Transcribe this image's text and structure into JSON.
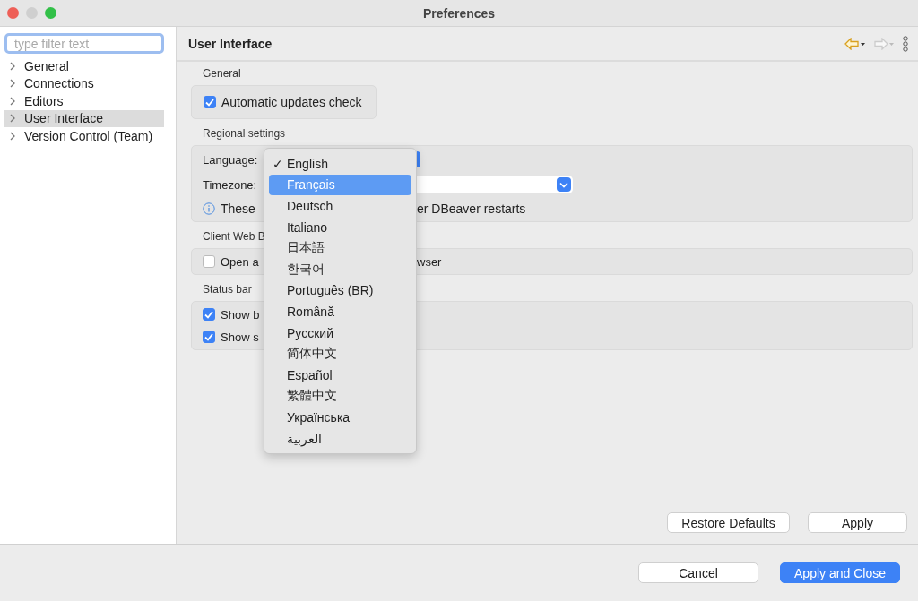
{
  "window": {
    "title": "Preferences"
  },
  "sidebar": {
    "filter_placeholder": "type filter text",
    "items": [
      {
        "label": "General",
        "selected": false
      },
      {
        "label": "Connections",
        "selected": false
      },
      {
        "label": "Editors",
        "selected": false
      },
      {
        "label": "User Interface",
        "selected": true
      },
      {
        "label": "Version Control (Team)",
        "selected": false
      }
    ]
  },
  "page": {
    "title": "User Interface"
  },
  "sections": [
    {
      "title": "General",
      "rows": [
        {
          "kind": "checkbox",
          "label": "Automatic updates check",
          "checked": true
        }
      ]
    },
    {
      "title": "Regional settings",
      "rows": [
        {
          "kind": "combo",
          "label": "Language:",
          "wide": false
        },
        {
          "kind": "combo",
          "label": "Timezone:",
          "wide": true
        },
        {
          "kind": "info",
          "label": "These",
          "label_after": "er DBeaver restarts"
        }
      ]
    },
    {
      "title": "Client Web B",
      "rows": [
        {
          "kind": "checkbox",
          "label": "Open a",
          "label_after": "wser",
          "checked": false
        }
      ]
    },
    {
      "title": "Status bar",
      "rows": [
        {
          "kind": "checkbox",
          "label": "Show b",
          "checked": true
        },
        {
          "kind": "checkbox",
          "label": "Show s",
          "checked": true
        }
      ]
    }
  ],
  "language_menu": {
    "items": [
      {
        "label": "English",
        "checked": true,
        "selected": false
      },
      {
        "label": "Français",
        "checked": false,
        "selected": true
      },
      {
        "label": "Deutsch",
        "checked": false,
        "selected": false
      },
      {
        "label": "Italiano",
        "checked": false,
        "selected": false
      },
      {
        "label": "日本語",
        "checked": false,
        "selected": false
      },
      {
        "label": "한국어",
        "checked": false,
        "selected": false
      },
      {
        "label": "Português (BR)",
        "checked": false,
        "selected": false
      },
      {
        "label": "Română",
        "checked": false,
        "selected": false
      },
      {
        "label": "Русский",
        "checked": false,
        "selected": false
      },
      {
        "label": "简体中文",
        "checked": false,
        "selected": false
      },
      {
        "label": "Español",
        "checked": false,
        "selected": false
      },
      {
        "label": "繁體中文",
        "checked": false,
        "selected": false
      },
      {
        "label": "Українська",
        "checked": false,
        "selected": false
      },
      {
        "label": "العربية",
        "checked": false,
        "selected": false
      }
    ],
    "check_mark": "✓"
  },
  "page_buttons": [
    "Restore Defaults",
    "Apply"
  ],
  "footer_buttons": [
    {
      "label": "Cancel",
      "primary": false
    },
    {
      "label": "Apply and Close",
      "primary": true
    }
  ]
}
